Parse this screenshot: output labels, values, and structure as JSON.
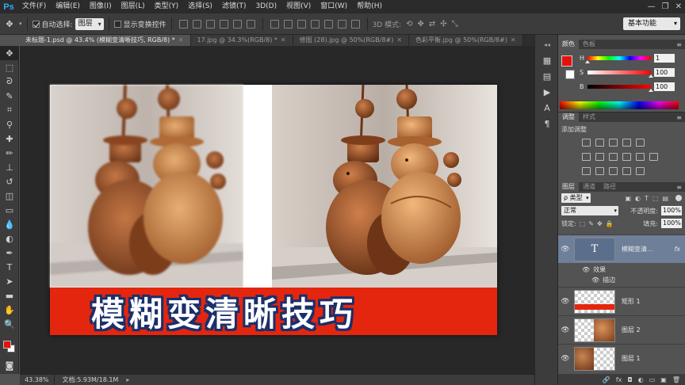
{
  "app": {
    "logo": "Ps"
  },
  "menu": [
    "文件(F)",
    "编辑(E)",
    "图像(I)",
    "图层(L)",
    "类型(Y)",
    "选择(S)",
    "滤镜(T)",
    "3D(D)",
    "视图(V)",
    "窗口(W)",
    "帮助(H)"
  ],
  "window_controls": {
    "minimize": "—",
    "restore": "❐",
    "close": "✕"
  },
  "options": {
    "auto_select_label": "自动选择:",
    "auto_select_target": "图层",
    "show_transform_label": "显示变换控件",
    "mode_3d_label": "3D 模式:",
    "workspace": "基本功能"
  },
  "tabs": [
    {
      "label": "未标题-1.psd @ 43.4% (模糊变清晰技巧, RGB/8) *",
      "active": true
    },
    {
      "label": "17.jpg @ 34.3%(RGB/8) *",
      "active": false
    },
    {
      "label": "修图 (28).jpg @ 50%(RGB/8#)",
      "active": false
    },
    {
      "label": "色彩平衡.jpg @ 50%(RGB/8#)",
      "active": false
    }
  ],
  "canvas": {
    "banner_text": "模糊变清晰技巧"
  },
  "status": {
    "zoom": "43.38%",
    "doc_info": "文档:5.93M/18.1M"
  },
  "colors": {
    "foreground": "#e5120c",
    "background": "#ffffff",
    "banner": "#e4260f",
    "selection": "#6d7f99"
  },
  "color_panel": {
    "tabs": [
      "颜色",
      "色板"
    ],
    "sliders": [
      {
        "name": "H",
        "value": "1",
        "fraction": 0.003
      },
      {
        "name": "S",
        "value": "100",
        "fraction": 1.0
      },
      {
        "name": "B",
        "value": "100",
        "fraction": 1.0
      }
    ]
  },
  "adjust_panel": {
    "tabs": [
      "调整",
      "样式"
    ],
    "title": "添加调整"
  },
  "layers_panel": {
    "tabs": [
      "图层",
      "通道",
      "路径"
    ],
    "filter_kind": "ρ 类型",
    "blend_mode": "正常",
    "opacity_label": "不透明度:",
    "opacity_value": "100%",
    "lock_label": "锁定:",
    "fill_label": "填充:",
    "fill_value": "100%",
    "layers": [
      {
        "name": "模糊变清...",
        "type": "text",
        "fx": "fx",
        "selected": true
      },
      {
        "name": "矩形 1",
        "type": "shape",
        "fx": "",
        "selected": false
      },
      {
        "name": "图层 2",
        "type": "image-right",
        "fx": "",
        "selected": false
      },
      {
        "name": "图层 1",
        "type": "image-left",
        "fx": "",
        "selected": false
      }
    ],
    "effects_label": "效果",
    "stroke_label": "描边"
  }
}
